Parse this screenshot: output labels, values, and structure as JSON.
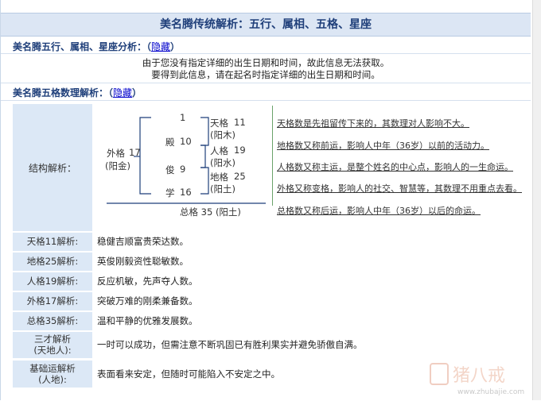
{
  "title": "美名腾传统解析：五行、属相、五格、星座",
  "section1": {
    "label": "美名腾五行、属相、星座分析：（",
    "link": "隐藏",
    "close": "）",
    "lines": [
      "由于您没有指定详细的出生日期和时间，故此信息无法获取。",
      "要得到此信息，请在起名时指定详细的出生日期和时间。"
    ]
  },
  "section2": {
    "label": "美名腾五格数理解析：（",
    "link": "隐藏",
    "close": "）"
  },
  "structure": {
    "label": "结构解析：",
    "chars": [
      {
        "char": "",
        "num": "1"
      },
      {
        "char": "殿",
        "num": "10"
      },
      {
        "char": "俊",
        "num": "9"
      },
      {
        "char": "学",
        "num": "16"
      }
    ],
    "outer": {
      "name": "外格",
      "num": "17",
      "wx": "(阳金)"
    },
    "tian": {
      "name": "天格",
      "num": "11",
      "wx": "(阳木)"
    },
    "ren": {
      "name": "人格",
      "num": "19",
      "wx": "(阳水)"
    },
    "di": {
      "name": "地格",
      "num": "25",
      "wx": "(阳土)"
    },
    "zong": "总格 35 (阳土)",
    "explanations": [
      "天格数是先祖留传下来的，其数理对人影响不大。",
      "地格数又称前运，影响人中年（36岁）以前的活动力。",
      "人格数又称主运，是整个姓名的中心点，影响人的一生命运。",
      "外格又称变格，影响人的社交、智慧等，其数理不用重点去看。",
      "总格数又称后运，影响人中年（36岁）以后的命运。"
    ]
  },
  "rows": [
    {
      "label": "天格11解析:",
      "value": "稳健吉顺富贵荣达数。"
    },
    {
      "label": "地格25解析:",
      "value": "英俊刚毅资性聪敏数。"
    },
    {
      "label": "人格19解析:",
      "value": "反应机敏，先声夺人数。"
    },
    {
      "label": "外格17解析:",
      "value": "突破万难的刚柔兼备数。"
    },
    {
      "label": "总格35解析:",
      "value": "温和平静的优雅发展数。"
    },
    {
      "label": "三才解析",
      "label2": "(天地人):",
      "value": "一时可以成功，但需注意不断巩固已有胜利果实并避免骄傲自满。"
    },
    {
      "label": "基础运解析",
      "label2": "(人地):",
      "value": "表面看来安定，但随时可能陷入不安定之中。"
    }
  ],
  "watermark": {
    "text": "猪八戒",
    "url": "www.zhubajie.com"
  }
}
